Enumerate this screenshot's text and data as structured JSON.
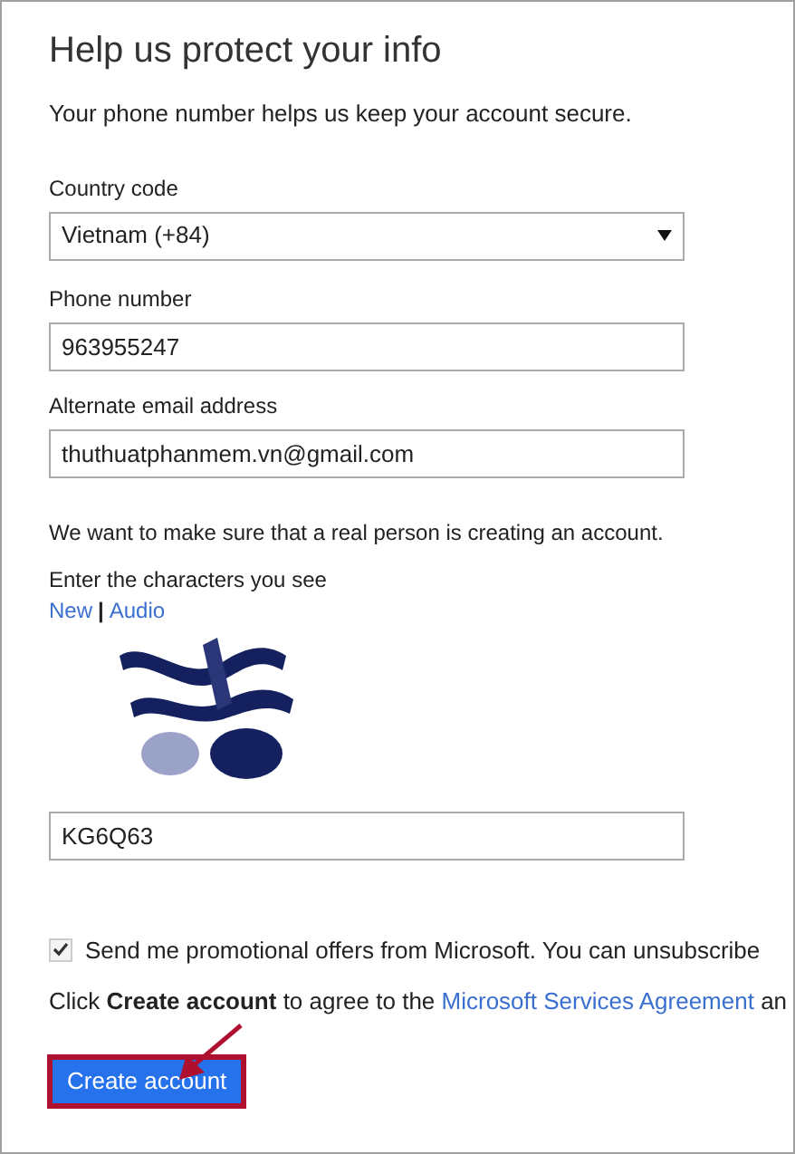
{
  "title": "Help us protect your info",
  "intro": "Your phone number helps us keep your account secure.",
  "country": {
    "label": "Country code",
    "value": "Vietnam (+84)"
  },
  "phone": {
    "label": "Phone number",
    "value": "963955247"
  },
  "alt_email": {
    "label": "Alternate email address",
    "value": "thuthuatphanmem.vn@gmail.com"
  },
  "captcha": {
    "note": "We want to make sure that a real person is creating an account.",
    "prompt": "Enter the characters you see",
    "links": [
      "New",
      "Audio"
    ],
    "separator": "|",
    "value": "KG6Q63"
  },
  "promo": {
    "label": "Send me promotional offers from Microsoft. You can unsubscribe",
    "checked": true
  },
  "agreement": {
    "text": "Click **Create account** to agree to the ",
    "link": "Microsoft Services Agreement",
    "after": " an"
  },
  "submit": {
    "label": "Create account",
    "highlighted": true
  }
}
